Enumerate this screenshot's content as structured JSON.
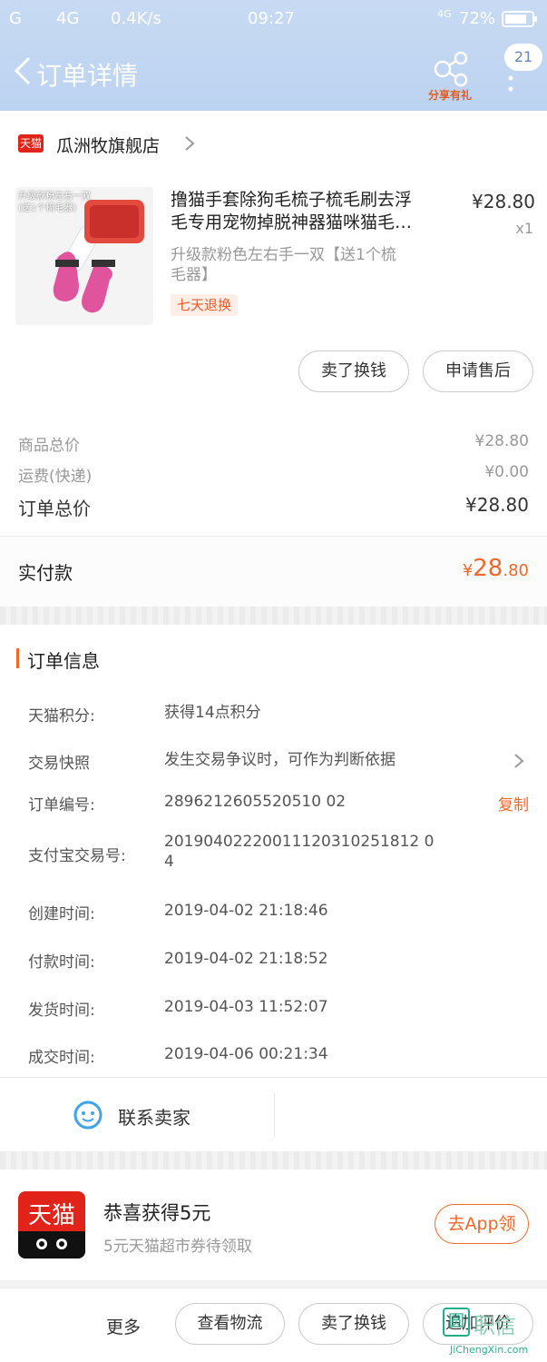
{
  "status_bar": {
    "signal": "G",
    "network": "4G",
    "speed": "0.4K/s",
    "time": "09:27",
    "network2": "4G",
    "battery": "72%"
  },
  "nav": {
    "title": "订单详情",
    "share_label": "分享有礼",
    "badge": "21"
  },
  "store": {
    "logo": "天猫",
    "name": "瓜洲牧旗舰店"
  },
  "product": {
    "thumb_text_1": "升级款粉左右一双",
    "thumb_text_2": "(送1个梳毛器)",
    "title_line1": "撸猫手套除狗毛梳子梳毛刷去浮",
    "title_line2": "毛专用宠物掉脱神器猫咪猫毛…",
    "price": "¥28.80",
    "qty": "x1",
    "sku_line1": "升级款粉色左右手一双【送1个梳",
    "sku_line2": "毛器】",
    "tag": "七天退换"
  },
  "item_actions": {
    "sell": "卖了换钱",
    "after_sale": "申请售后"
  },
  "summary": {
    "goods_label": "商品总价",
    "goods_value": "¥28.80",
    "shipping_label": "运费(快递)",
    "shipping_value": "¥0.00",
    "total_label": "订单总价",
    "total_value": "¥28.80"
  },
  "paid": {
    "label": "实付款",
    "currency": "¥",
    "int": "28",
    "dec": ".80"
  },
  "order_info": {
    "title": "订单信息",
    "points_label": "天猫积分:",
    "points_value": "获得14点积分",
    "snapshot_label": "交易快照",
    "snapshot_value": "发生交易争议时，可作为判断依据",
    "order_no_label": "订单编号:",
    "order_no_value": "2896212605520510 02",
    "copy": "复制",
    "alipay_label": "支付宝交易号:",
    "alipay_value_1": "20190402220011120310251812 0",
    "alipay_value_2": "4",
    "created_label": "创建时间:",
    "created_value": "2019-04-02 21:18:46",
    "paid_label": "付款时间:",
    "paid_value": "2019-04-02 21:18:52",
    "shipped_label": "发货时间:",
    "shipped_value": "2019-04-03 11:52:07",
    "deal_label": "成交时间:",
    "deal_value": "2019-04-06 00:21:34"
  },
  "contact": {
    "label": "联系卖家"
  },
  "promo": {
    "logo": "天猫",
    "title": "恭喜获得5元",
    "subtitle": "5元天猫超市券待领取",
    "button": "去App领"
  },
  "bottom": {
    "more": "更多",
    "logistics": "查看物流",
    "sell": "卖了换钱",
    "review": "追加评价"
  },
  "watermark": {
    "mark": "圆",
    "name": "职信",
    "url": "JiChengXin.com"
  }
}
